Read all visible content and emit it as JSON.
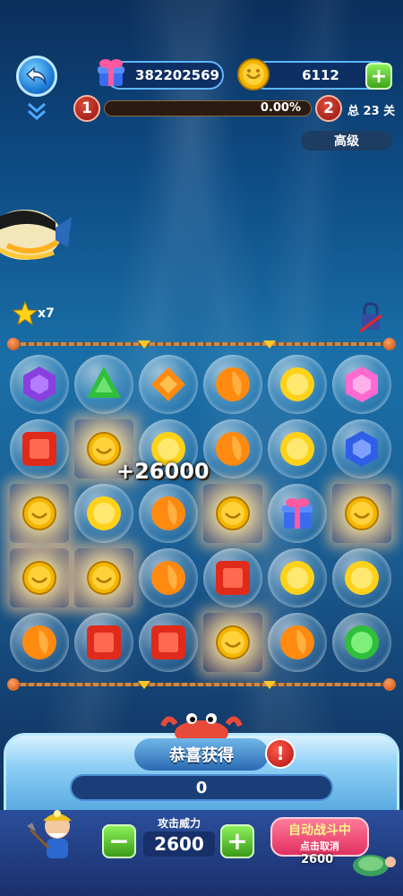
{
  "header": {
    "gift_count": "382202569",
    "coin_count": "6112",
    "current_level": "1",
    "next_level": "2",
    "progress": "0.00%",
    "progress_fraction": 0.0,
    "total_levels": "总 23 关",
    "difficulty": "高级"
  },
  "side": {
    "star_multiplier": "x7"
  },
  "board": {
    "combo_bonus": "+26000",
    "rows": [
      [
        {
          "piece": "purple-gem",
          "glow": false
        },
        {
          "piece": "green-gem",
          "glow": false
        },
        {
          "piece": "orange-diamond",
          "glow": false
        },
        {
          "piece": "orange-drop",
          "glow": false
        },
        {
          "piece": "yellow-round",
          "glow": false
        },
        {
          "piece": "pink-gem",
          "glow": false
        }
      ],
      [
        {
          "piece": "red-square",
          "glow": false
        },
        {
          "piece": "coin",
          "glow": true
        },
        {
          "piece": "yellow-round",
          "glow": false
        },
        {
          "piece": "orange-drop",
          "glow": false
        },
        {
          "piece": "yellow-round",
          "glow": false
        },
        {
          "piece": "blue-gem",
          "glow": false
        }
      ],
      [
        {
          "piece": "coin",
          "glow": true
        },
        {
          "piece": "yellow-round",
          "glow": false
        },
        {
          "piece": "orange-drop",
          "glow": false
        },
        {
          "piece": "coin",
          "glow": true
        },
        {
          "piece": "gift",
          "glow": false
        },
        {
          "piece": "coin",
          "glow": true
        }
      ],
      [
        {
          "piece": "coin",
          "glow": true
        },
        {
          "piece": "coin",
          "glow": true
        },
        {
          "piece": "orange-drop",
          "glow": false
        },
        {
          "piece": "red-square",
          "glow": false
        },
        {
          "piece": "yellow-round",
          "glow": false
        },
        {
          "piece": "yellow-round",
          "glow": false
        }
      ],
      [
        {
          "piece": "orange-drop",
          "glow": false
        },
        {
          "piece": "red-square",
          "glow": false
        },
        {
          "piece": "red-square",
          "glow": false
        },
        {
          "piece": "coin",
          "glow": true
        },
        {
          "piece": "orange-drop",
          "glow": false
        },
        {
          "piece": "green-round",
          "glow": false
        }
      ]
    ]
  },
  "reward_panel": {
    "title": "恭喜获得",
    "amount": "0"
  },
  "controls": {
    "attack_label": "攻击威力",
    "attack_value": "2600",
    "minus": "−",
    "plus": "+",
    "auto_main": "自动战斗中",
    "auto_sub": "点击取消",
    "cost": "2600"
  },
  "colors": {
    "purple": "#8a3fe0",
    "green": "#2fbf3a",
    "orange": "#ff8a10",
    "yellow": "#ffd21a",
    "pink": "#ff6ad0",
    "blue": "#2f5fe8",
    "red": "#e02a1a"
  }
}
